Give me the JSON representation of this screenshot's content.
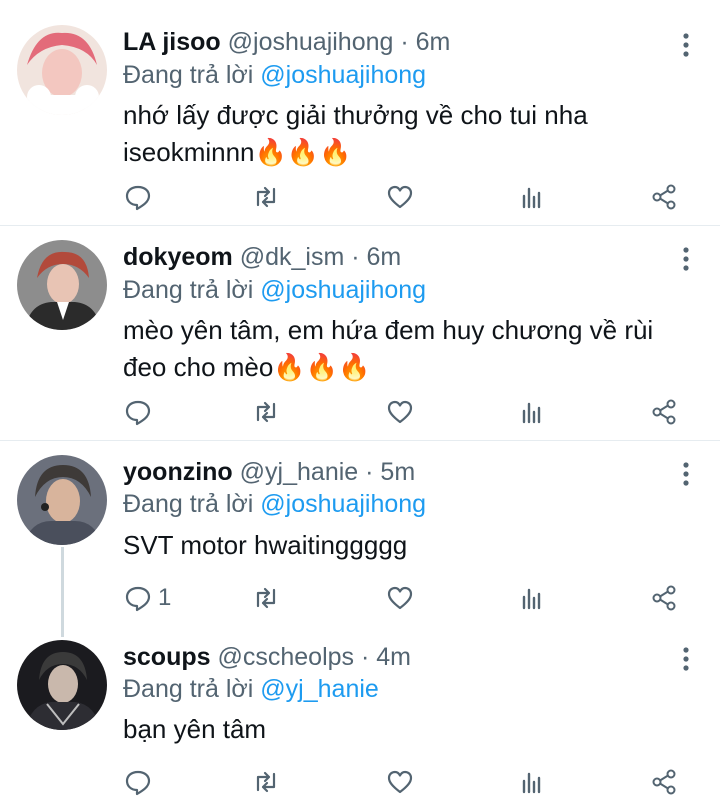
{
  "tweets": [
    {
      "name": "LA jisoo",
      "handle": "@joshuajihong",
      "time": "6m",
      "reply_prefix": "Đang trả lời",
      "reply_to": "@joshuajihong",
      "text": "nhớ lấy được giải thưởng về cho tui nha iseokminnn",
      "emoji": "🔥🔥🔥",
      "reply_count": "",
      "avatar_colors": [
        "#e36b7a",
        "#f3c7c0"
      ]
    },
    {
      "name": "dokyeom",
      "handle": "@dk_ism",
      "time": "6m",
      "reply_prefix": "Đang trả lời",
      "reply_to": "@joshuajihong",
      "text": "mèo yên tâm, em hứa đem huy chương về rùi đeo cho mèo",
      "emoji": "🔥🔥🔥",
      "reply_count": "",
      "avatar_colors": [
        "#b24a3b",
        "#2b2b2b"
      ]
    },
    {
      "name": "yoonzino",
      "handle": "@yj_hanie",
      "time": "5m",
      "reply_prefix": "Đang trả lời",
      "reply_to": "@joshuajihong",
      "text": "SVT motor hwaitinggggg",
      "emoji": "",
      "reply_count": "1",
      "avatar_colors": [
        "#5a5e6b",
        "#c9a991"
      ]
    },
    {
      "name": "scoups",
      "handle": "@cscheolps",
      "time": "4m",
      "reply_prefix": "Đang trả lời",
      "reply_to": "@yj_hanie",
      "text": "bạn yên tâm",
      "emoji": "",
      "reply_count": "",
      "avatar_colors": [
        "#1b1b1f",
        "#8a7f76"
      ]
    }
  ],
  "separator": "·",
  "icons": {
    "reply": "comment-icon",
    "retweet": "retweet-icon",
    "like": "heart-icon",
    "views": "analytics-icon",
    "share": "share-icon",
    "more": "more-vertical-icon"
  },
  "colors": {
    "mention": "#1d9bf0",
    "secondary": "#536471",
    "divider": "#e6ecf0"
  }
}
